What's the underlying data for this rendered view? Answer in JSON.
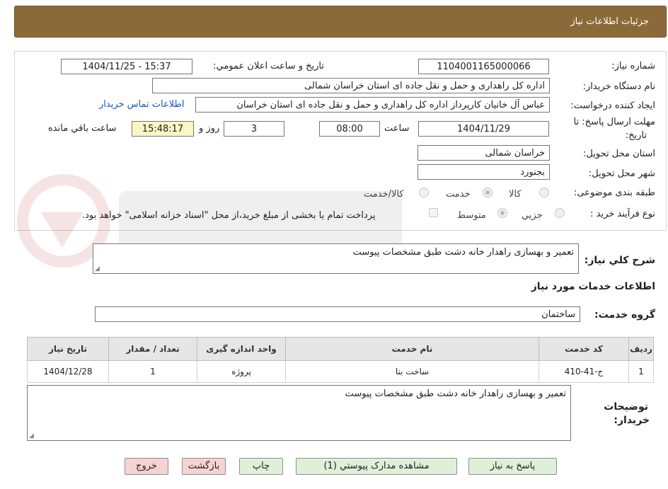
{
  "header": {
    "title": "جزئيات اطلاعات نياز"
  },
  "form": {
    "need_number_label": "شماره نياز:",
    "need_number": "1104001165000066",
    "announce_label": "تاريخ و ساعت اعلان عمومي:",
    "announce_value": "1404/11/25 - 15:37",
    "buyer_org_label": "نام دستگاه خريدار:",
    "buyer_org": "اداره کل راهداری و حمل و نقل جاده ای استان خراسان شمالی",
    "requester_label": "ايجاد کننده درخواست:",
    "requester": "عباس آل خانیان کارپرداز اداره کل راهداری و حمل و نقل جاده ای استان خراسان",
    "contact_link": "اطلاعات تماس خريدار",
    "deadline_label_1": "مهلت ارسال پاسخ: تا",
    "deadline_label_2": "تاريخ:",
    "deadline_date": "1404/11/29",
    "time_label": "ساعت",
    "deadline_time": "08:00",
    "days_value": "3",
    "days_label": "روز و",
    "remaining_time": "15:48:17",
    "remaining_label": "ساعت باقي مانده",
    "province_label": "استان محل تحويل:",
    "province": "خراسان شمالی",
    "city_label": "شهر محل تحويل:",
    "city": "بجنورد",
    "category_label": "طبقه بندی موضوعی:",
    "category_options": [
      "کالا",
      "خدمت",
      "کالا/خدمت"
    ],
    "process_label": "نوع فرآيند خريد :",
    "process_options": [
      "جزيي",
      "متوسط"
    ],
    "payment_note": "پرداخت تمام يا بخشی از مبلغ خريد،از محل \"اسناد خزانه اسلامی\" خواهد بود."
  },
  "summary": {
    "label": "شرح کلي نياز:",
    "text": "تعمیر و بهسازی راهدار خانه دشت طبق مشخصات پیوست"
  },
  "services": {
    "section_title": "اطلاعات خدمات مورد نياز",
    "group_label": "گروه خدمت:",
    "group_value": "ساختمان",
    "table": {
      "headers": [
        "رديف",
        "کد خدمت",
        "نام خدمت",
        "واحد اندازه گيری",
        "تعداد / مقدار",
        "تاريخ نياز"
      ],
      "rows": [
        [
          "1",
          "ج-41-410",
          "ساخت بنا",
          "پروژه",
          "1",
          "1404/12/28"
        ]
      ]
    }
  },
  "buyer_notes": {
    "label_1": "توضيحات",
    "label_2": "خريدار:",
    "text": "تعمیر و بهسازی راهدار خانه دشت طبق مشخصات پیوست"
  },
  "buttons": {
    "reply": "پاسخ به نياز",
    "attachments": "مشاهده مدارک پيوستي (1)",
    "print": "چاپ",
    "back": "بازگشت",
    "exit": "خروج"
  },
  "colors": {
    "header_bg": "#8b6a3a",
    "link": "#1a54c8",
    "green_btn": "#dff0d8",
    "red_btn": "#f7d2d2"
  }
}
